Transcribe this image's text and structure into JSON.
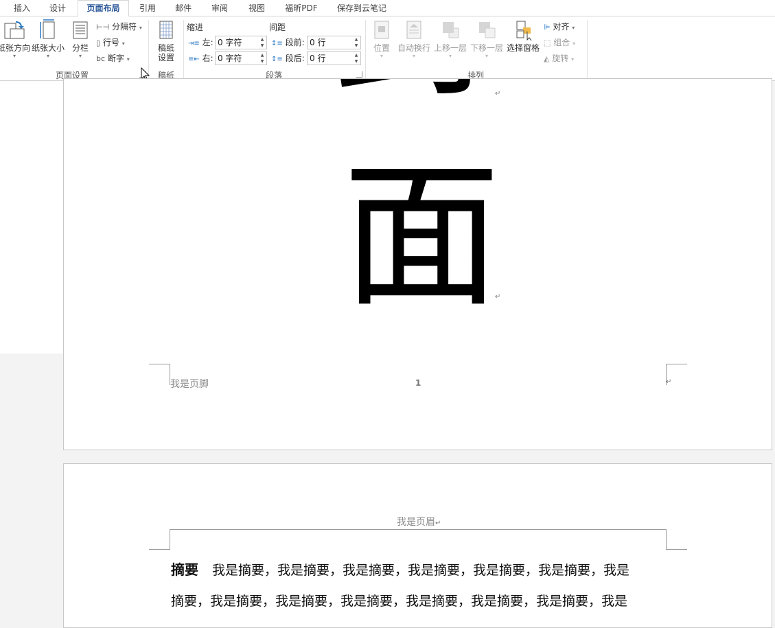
{
  "tabs": [
    {
      "label": "插入",
      "active": false
    },
    {
      "label": "设计",
      "active": false
    },
    {
      "label": "页面布局",
      "active": true
    },
    {
      "label": "引用",
      "active": false
    },
    {
      "label": "邮件",
      "active": false
    },
    {
      "label": "审阅",
      "active": false
    },
    {
      "label": "视图",
      "active": false
    },
    {
      "label": "福昕PDF",
      "active": false
    },
    {
      "label": "保存到云笔记",
      "active": false
    }
  ],
  "page_setup": {
    "group_label": "页面设置",
    "orientation": "纸张方向",
    "size": "纸张大小",
    "columns": "分栏",
    "breaks": "分隔符",
    "line_numbers": "行号",
    "hyphenation": "断字"
  },
  "manuscript": {
    "group_label": "稿纸",
    "button_line1": "稿纸",
    "button_line2": "设置"
  },
  "paragraph": {
    "group_label": "段落",
    "indent_head": "缩进",
    "spacing_head": "间距",
    "left_label": "左:",
    "left_value": "0 字符",
    "right_label": "右:",
    "right_value": "0 字符",
    "before_label": "段前:",
    "before_value": "0 行",
    "after_label": "段后:",
    "after_value": "0 行"
  },
  "arrange": {
    "group_label": "排列",
    "position": "位置",
    "wrap": "自动换行",
    "forward": "上移一层",
    "backward": "下移一层",
    "selection_pane": "选择窗格",
    "align": "对齐",
    "group": "组合",
    "rotate": "旋转"
  },
  "page1": {
    "char_partial": "封",
    "char_main": "面",
    "footer_text": "我是页脚",
    "page_number": "1"
  },
  "page2": {
    "header_text": "我是页眉",
    "abstract_heading": "摘要",
    "line1": "我是摘要，我是摘要，我是摘要，我是摘要，我是摘要，我是摘要，我是",
    "line2": "摘要，我是摘要，我是摘要，我是摘要，我是摘要，我是摘要，我是摘要，我是"
  },
  "colors": {
    "accent": "#2b579a",
    "ribbon_bg": "#ffffff",
    "canvas_bg": "#f3f3f3"
  }
}
